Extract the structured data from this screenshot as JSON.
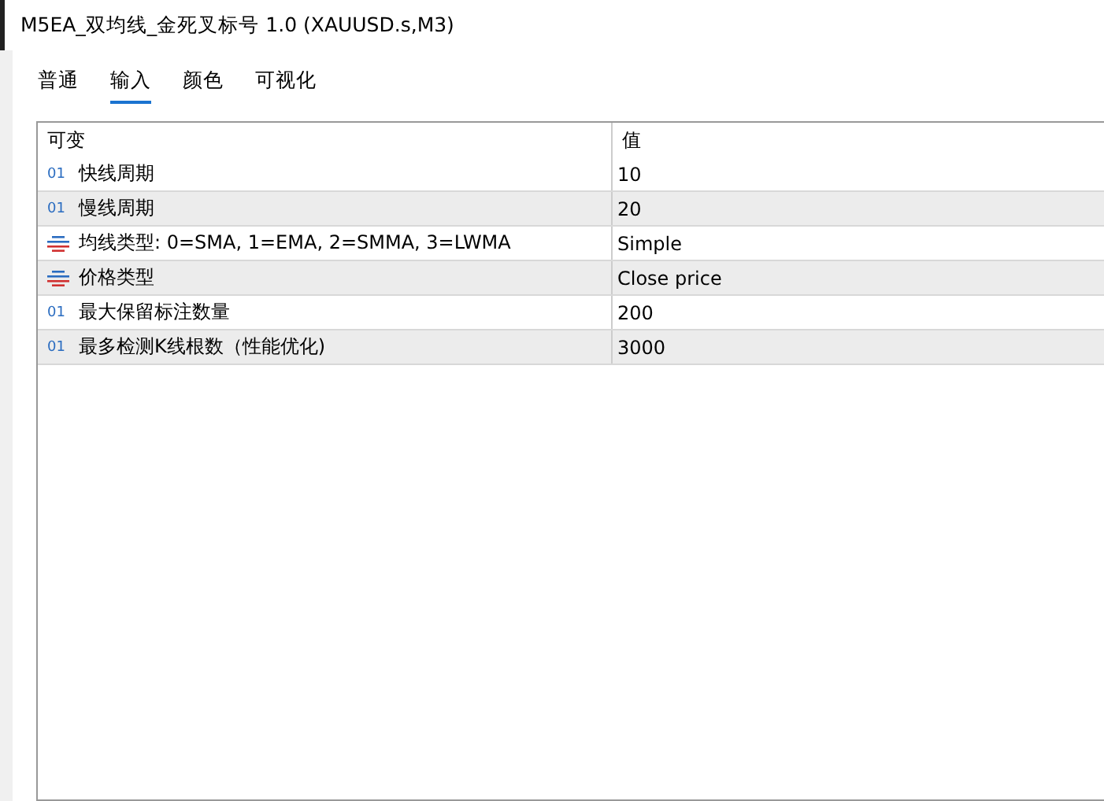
{
  "window": {
    "title": "M5EA_双均线_金死叉标号 1.0 (XAUUSD.s,M3)"
  },
  "tabs": [
    {
      "label": "普通",
      "selected": false
    },
    {
      "label": "输入",
      "selected": true
    },
    {
      "label": "颜色",
      "selected": false
    },
    {
      "label": "可视化",
      "selected": false
    }
  ],
  "table": {
    "columns": [
      "可变",
      "值"
    ],
    "rows": [
      {
        "kind": "int",
        "type_label": "01",
        "name": "快线周期",
        "value": "10"
      },
      {
        "kind": "int",
        "type_label": "01",
        "name": "慢线周期",
        "value": "20"
      },
      {
        "kind": "enum",
        "name": "均线类型: 0=SMA, 1=EMA, 2=SMMA, 3=LWMA",
        "value": "Simple"
      },
      {
        "kind": "enum",
        "name": "价格类型",
        "value": "Close price"
      },
      {
        "kind": "int",
        "type_label": "01",
        "name": "最大保留标注数量",
        "value": "200"
      },
      {
        "kind": "int",
        "type_label": "01",
        "name": "最多检测K线根数（性能优化)",
        "value": "3000"
      }
    ]
  }
}
